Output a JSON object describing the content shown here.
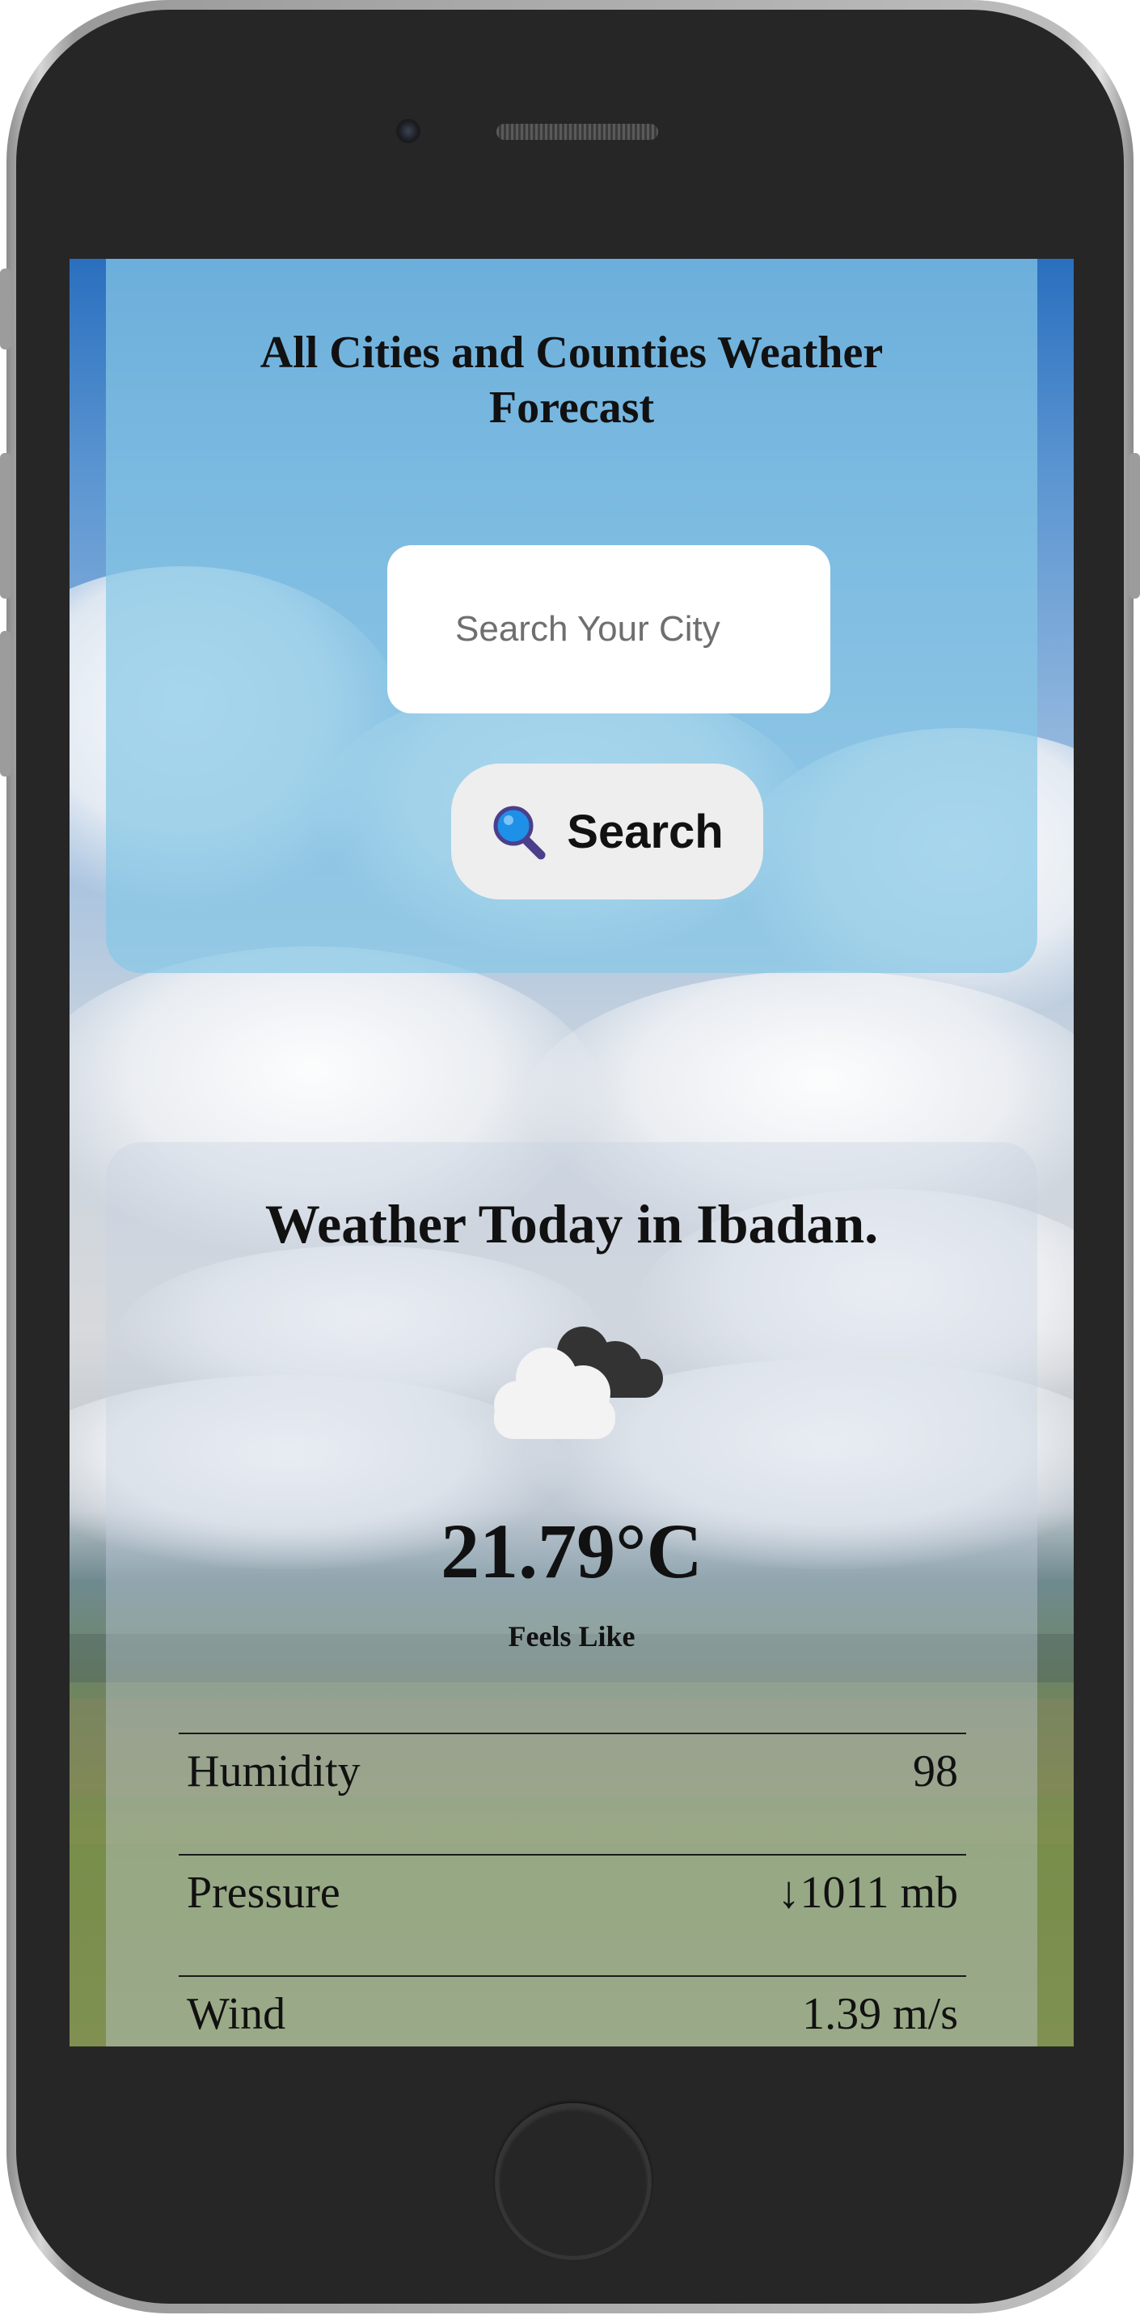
{
  "app": {
    "title": "All Cities and Counties Weather Forecast"
  },
  "search": {
    "placeholder": "Search Your City",
    "value": "",
    "button_label": "Search",
    "button_icon": "magnifying-glass-icon"
  },
  "weather": {
    "heading": "Weather Today in Ibadan.",
    "icon": "cloud-icon",
    "temperature": "21.79°C",
    "feels_like_label": "Feels Like",
    "stats": [
      {
        "label": "Humidity",
        "value": "98"
      },
      {
        "label": "Pressure",
        "value": "↓1011 mb"
      },
      {
        "label": "Wind",
        "value": "1.39 m/s"
      }
    ]
  },
  "colors": {
    "search_card": "#87c8e6",
    "search_button": "#eeeeee",
    "text": "#111111",
    "icon_blue": "#1e90e8",
    "icon_handle": "#4b3f8c"
  }
}
